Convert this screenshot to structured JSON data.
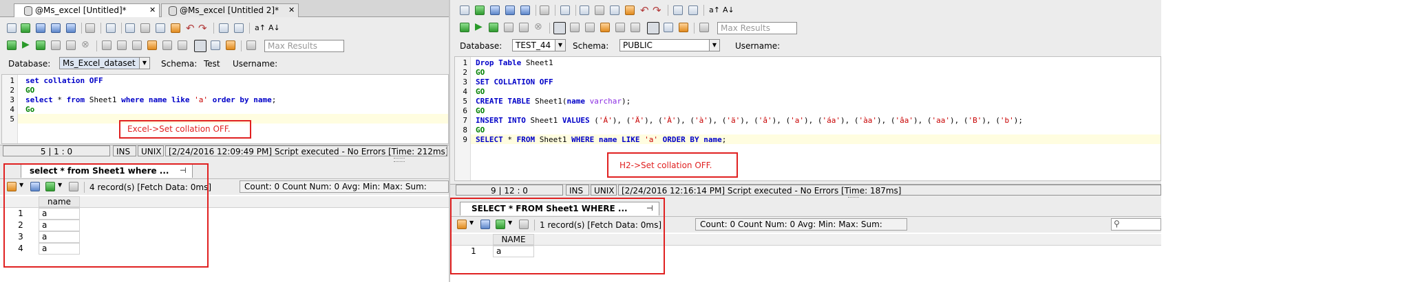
{
  "left": {
    "tabs": [
      {
        "label": "@Ms_excel [Untitled]*",
        "active": true
      },
      {
        "label": "@Ms_excel [Untitled 2]*",
        "active": false
      }
    ],
    "max_results_placeholder": "Max Results",
    "database_label": "Database:",
    "database_value": "Ms_Excel_dataset",
    "schema_label": "Schema:",
    "schema_value": "Test",
    "username_label": "Username:",
    "line_numbers": [
      "1",
      "2",
      "3",
      "4",
      "5"
    ],
    "status_position": "5 | 1 : 0",
    "status_ins": "INS",
    "status_unix": "UNIX",
    "status_message": "[2/24/2016 12:09:49 PM] Script executed - No Errors [Time: 212ms]",
    "result_tab": "select * from Sheet1 where ...",
    "records_text": "4 record(s) [Fetch Data: 0ms]",
    "stats": "Count: 0  Count Num: 0  Avg:   Min:   Max:   Sum:",
    "column_header": "name",
    "rows": [
      {
        "num": "1",
        "value": "a"
      },
      {
        "num": "2",
        "value": "a"
      },
      {
        "num": "3",
        "value": "a"
      },
      {
        "num": "4",
        "value": "a"
      }
    ],
    "annotation": "Excel->Set collation OFF."
  },
  "right": {
    "max_results_placeholder": "Max Results",
    "database_label": "Database:",
    "database_value": "TEST_44",
    "schema_label": "Schema:",
    "schema_value": "PUBLIC",
    "username_label": "Username:",
    "line_numbers": [
      "1",
      "2",
      "3",
      "4",
      "5",
      "6",
      "7",
      "8",
      "9"
    ],
    "status_position": "9 | 12 : 0",
    "status_ins": "INS",
    "status_unix": "UNIX",
    "status_message": "[2/24/2016 12:16:14 PM] Script executed - No Errors [Time: 187ms]",
    "result_tab": "SELECT * FROM Sheet1 WHERE ...",
    "records_text": "1 record(s) [Fetch Data: 0ms]",
    "stats": "Count: 0  Count Num: 0  Avg:   Min:   Max:   Sum:",
    "column_header": "NAME",
    "rows": [
      {
        "num": "1",
        "value": "a"
      }
    ],
    "annotation": "H2->Set collation OFF."
  },
  "colors": {
    "annotation": "#e02020",
    "keyword": "#0000c8",
    "go": "#008000",
    "string": "#c80000",
    "active_line": "#fffde0"
  }
}
